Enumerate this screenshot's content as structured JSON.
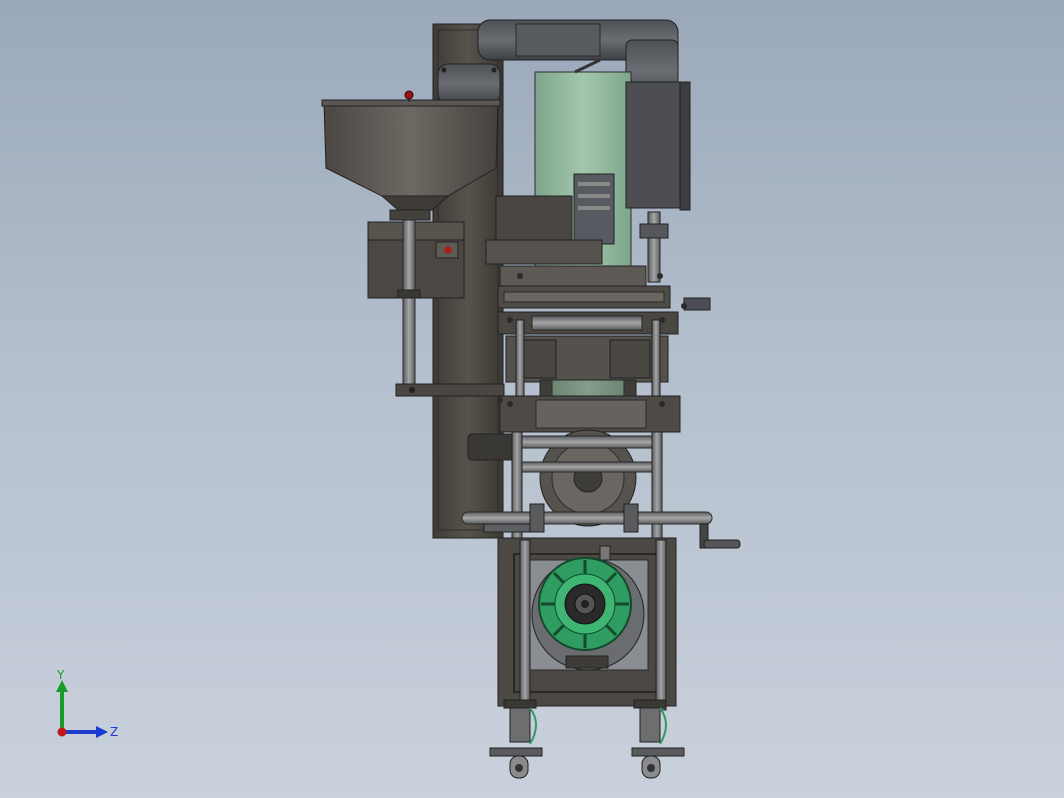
{
  "view": {
    "model": "packaging-machine-assembly",
    "orientation": "side"
  },
  "triad": {
    "y_label": "Y",
    "z_label": "Z",
    "y_color": "#1a9a2a",
    "z_color": "#1a3ad0",
    "x_color": "#c01818"
  },
  "colors": {
    "background_top": "#9aa8ba",
    "background_bottom": "#c9d1dc",
    "frame": "#4d4a44",
    "frame_dark": "#2e2d2a",
    "steel": "#6f7072",
    "pale_green": "#8fb59c",
    "sprocket_green": "#2f9c62",
    "hopper": "#5a5650"
  }
}
